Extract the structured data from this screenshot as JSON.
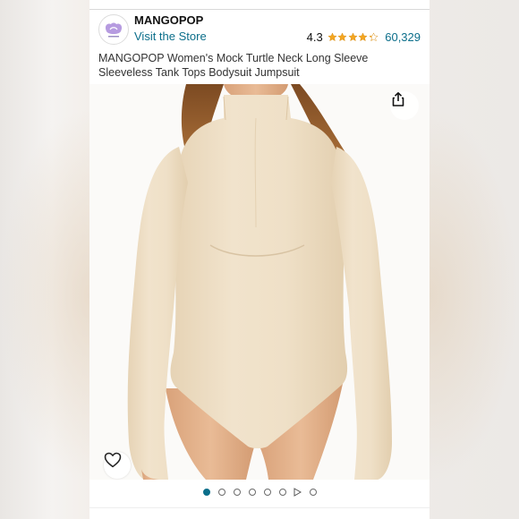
{
  "store": {
    "brand_name": "MANGOPOP",
    "visit_link": "Visit the Store",
    "logo_icon": "mangopop-logo-icon"
  },
  "rating": {
    "value": "4.3",
    "stars_filled": 4.3,
    "stars_max": 5,
    "review_count": "60,329",
    "star_color": "#f4a622"
  },
  "product": {
    "title": "MANGOPOP Women's Mock Turtle Neck Long Sleeve Sleeveless Tank Tops Bodysuit Jumpsuit",
    "image_icon": "product-photo-bodysuit"
  },
  "actions": {
    "share_icon": "share-icon",
    "favorite_icon": "heart-icon"
  },
  "carousel": {
    "image_dot_count": 7,
    "active_index": 0,
    "has_video": true,
    "active_color": "#0b6e8a"
  },
  "colors": {
    "link": "#0b6e8a",
    "garment": "#ecdcc2",
    "skin": "#e0ae86",
    "hair": "#9a5e2c"
  }
}
